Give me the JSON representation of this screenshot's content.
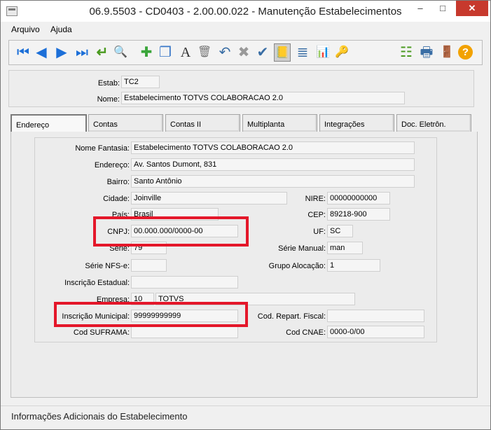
{
  "window": {
    "title": "06.9.5503 - CD0403 - 2.00.00.022 - Manutenção Estabelecimentos",
    "minimize": "–",
    "maximize": "□",
    "close": "✕"
  },
  "menu": [
    "Arquivo",
    "Ajuda"
  ],
  "toolbar": {
    "icons": [
      "first-record-icon",
      "previous-record-icon",
      "next-record-icon",
      "last-record-icon",
      "goto-icon",
      "search-icon",
      "add-icon",
      "copy-icon",
      "edit-icon",
      "delete-icon",
      "undo-icon",
      "cancel-icon",
      "save-icon",
      "notebook-icon",
      "list-icon",
      "report-icon",
      "key-icon",
      "tree-icon",
      "print-icon",
      "exit-icon",
      "help-icon"
    ],
    "glyphs": [
      "⏮",
      "◀",
      "▶",
      "⏭",
      "↵",
      "🔍",
      "✚",
      "❐",
      "A",
      "🗑",
      "↶",
      "✖",
      "✔",
      "📒",
      "≣",
      "📊",
      "🔑",
      "☷",
      "🖶",
      "🚪",
      "?"
    ],
    "selected": "notebook-icon"
  },
  "header": {
    "estab_label": "Estab:",
    "estab_value": "TC2",
    "nome_label": "Nome:",
    "nome_value": "Estabelecimento TOTVS COLABORACAO 2.0"
  },
  "tabs": [
    "Endereço",
    "Contas",
    "Contas II",
    "Multiplanta",
    "Integrações",
    "Doc. Eletrôn."
  ],
  "active_tab": "Endereço",
  "form": {
    "nome_fantasia_label": "Nome Fantasia:",
    "nome_fantasia": "Estabelecimento TOTVS COLABORACAO 2.0",
    "endereco_label": "Endereço:",
    "endereco": "Av. Santos Dumont, 831",
    "bairro_label": "Bairro:",
    "bairro": "Santo Antônio",
    "cidade_label": "Cidade:",
    "cidade": "Joinville",
    "nire_label": "NIRE:",
    "nire": "00000000000",
    "pais_label": "País:",
    "pais": "Brasil",
    "cep_label": "CEP:",
    "cep": "89218-900",
    "cnpj_label": "CNPJ:",
    "cnpj": "00.000.000/0000-00",
    "uf_label": "UF:",
    "uf": "SC",
    "serie_label": "Série:",
    "serie": "79",
    "serie_manual_label": "Série Manual:",
    "serie_manual": "man",
    "serie_nfse_label": "Série NFS-e:",
    "serie_nfse": "",
    "grupo_alocacao_label": "Grupo Alocação:",
    "grupo_alocacao": "1",
    "inscricao_estadual_label": "Inscrição Estadual:",
    "inscricao_estadual": "",
    "empresa_label": "Empresa:",
    "empresa_codigo": "10",
    "empresa_nome": "TOTVS",
    "inscricao_municipal_label": "Inscrição Municipal:",
    "inscricao_municipal": "99999999999",
    "cod_repart_fiscal_label": "Cod. Repart. Fiscal:",
    "cod_repart_fiscal": "",
    "cod_suframa_label": "Cod SUFRAMA:",
    "cod_suframa": "",
    "cod_cnae_label": "Cod CNAE:",
    "cod_cnae": "0000-0/00"
  },
  "highlight_color": "#e4172a",
  "status": "Informações Adicionais do Estabelecimento"
}
